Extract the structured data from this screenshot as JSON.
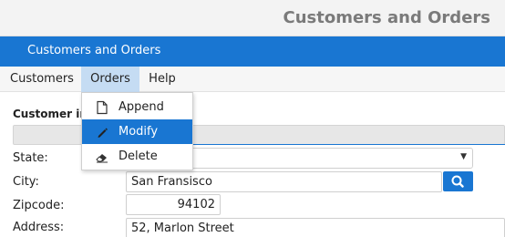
{
  "window": {
    "title": "Customers and Orders"
  },
  "header": {
    "title": "Customers and Orders"
  },
  "menubar": {
    "items": [
      "Customers",
      "Orders",
      "Help"
    ]
  },
  "orders_menu": {
    "items": [
      {
        "label": "Append",
        "icon": "document-icon"
      },
      {
        "label": "Modify",
        "icon": "pencil-icon"
      },
      {
        "label": "Delete",
        "icon": "eraser-icon"
      }
    ],
    "selected": "Modify"
  },
  "form": {
    "section_title": "Customer info",
    "state_label": "State:",
    "city_label": "City:",
    "city_value": "San Fransisco",
    "zipcode_label": "Zipcode:",
    "zipcode_value": "94102",
    "address_label": "Address:",
    "address_value": "52, Marlon Street",
    "search_icon": "search-icon"
  },
  "colors": {
    "accent": "#1976d2",
    "menu_active": "#c5dcf3"
  }
}
